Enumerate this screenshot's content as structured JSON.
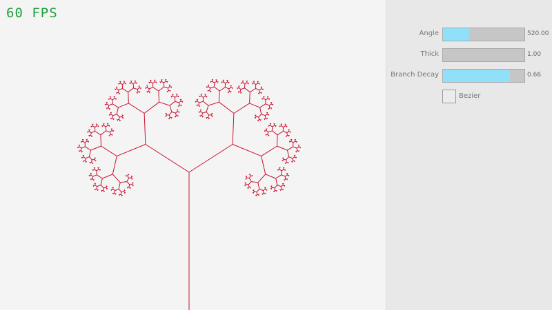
{
  "fps": {
    "text": "60 FPS",
    "color": "#1e9f3c"
  },
  "canvas": {
    "background": "#f4f4f4",
    "tree_color": "#c8102e"
  },
  "panel": {
    "background": "#e8e8e8",
    "sliders": [
      {
        "label": "Angle",
        "value_text": "520.00",
        "fill_fraction": 0.32
      },
      {
        "label": "Thick",
        "value_text": "1.00",
        "fill_fraction": 0.0
      },
      {
        "label": "Branch Decay",
        "value_text": "0.66",
        "fill_fraction": 0.82
      }
    ],
    "checkbox": {
      "label": "Bezier",
      "checked": false
    }
  }
}
